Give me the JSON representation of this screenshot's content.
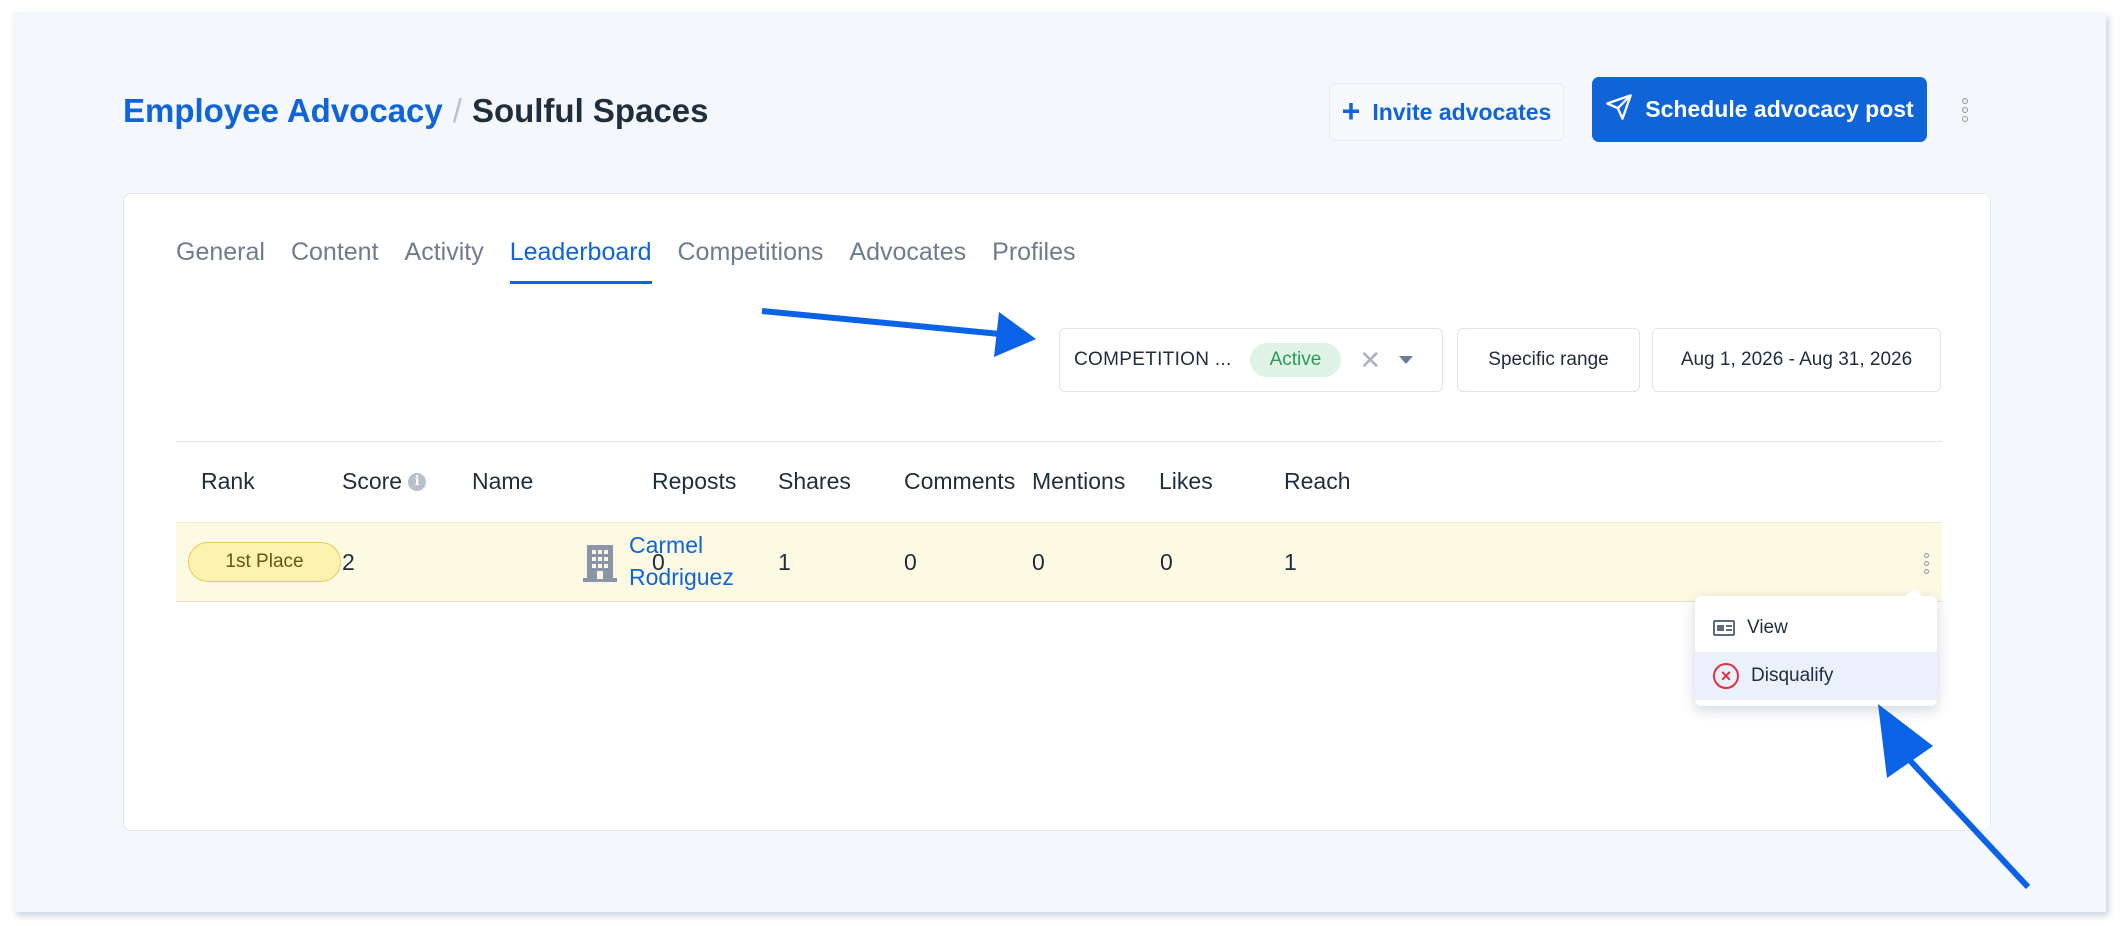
{
  "breadcrumb": {
    "root": "Employee Advocacy",
    "separator": "/",
    "current": "Soulful Spaces"
  },
  "header_actions": {
    "invite_label": "Invite advocates",
    "schedule_label": "Schedule advocacy post"
  },
  "tabs": [
    {
      "label": "General",
      "active": false
    },
    {
      "label": "Content",
      "active": false
    },
    {
      "label": "Activity",
      "active": false
    },
    {
      "label": "Leaderboard",
      "active": true
    },
    {
      "label": "Competitions",
      "active": false
    },
    {
      "label": "Advocates",
      "active": false
    },
    {
      "label": "Profiles",
      "active": false
    }
  ],
  "filters": {
    "competition_label": "COMPETITION ...",
    "competition_status": "Active",
    "range_label": "Specific range",
    "date_range": "Aug 1, 2026 - Aug 31, 2026"
  },
  "table": {
    "columns": [
      "Rank",
      "Score",
      "Name",
      "Reposts",
      "Shares",
      "Comments",
      "Mentions",
      "Likes",
      "Reach"
    ],
    "rows": [
      {
        "rank": "1st Place",
        "score": "2",
        "name_first": "Carmel",
        "name_last": "Rodriguez",
        "reposts": "0",
        "shares": "1",
        "comments": "0",
        "mentions": "0",
        "likes": "0",
        "reach": "1"
      }
    ]
  },
  "row_menu": {
    "items": [
      {
        "label": "View",
        "icon": "view-icon"
      },
      {
        "label": "Disqualify",
        "icon": "disqualify-icon"
      }
    ]
  },
  "colors": {
    "accent": "#0f64d8",
    "active_badge_bg": "#dff3e6",
    "active_badge_text": "#2c9a56",
    "rank_badge_bg": "#fdf3b0",
    "row_highlight": "#fdfae4",
    "danger": "#e03142"
  }
}
